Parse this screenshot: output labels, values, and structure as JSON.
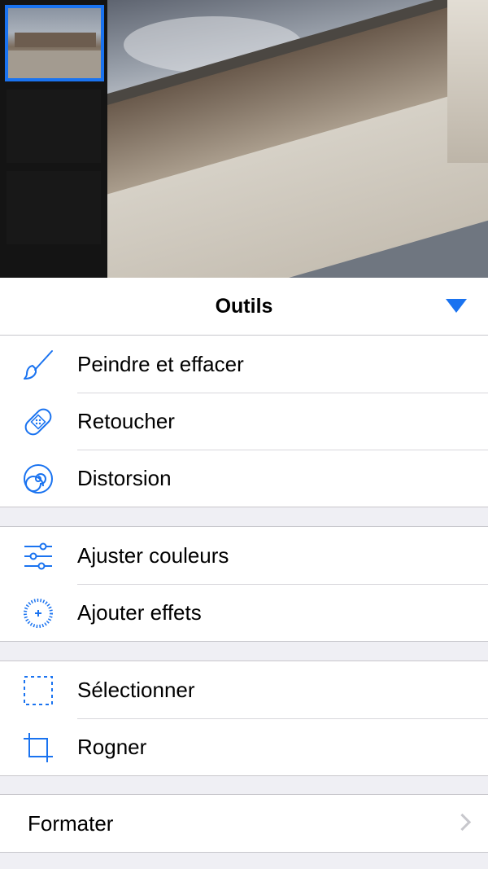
{
  "colors": {
    "accent": "#1a73f0",
    "separator": "#c8c7cc",
    "background": "#efeff4"
  },
  "header": {
    "title": "Outils",
    "collapse_icon": "triangle-down-icon"
  },
  "groups": [
    {
      "items": [
        {
          "label": "Peindre et effacer",
          "icon": "brush-icon"
        },
        {
          "label": "Retoucher",
          "icon": "bandage-icon"
        },
        {
          "label": "Distorsion",
          "icon": "spiral-icon"
        }
      ]
    },
    {
      "items": [
        {
          "label": "Ajuster couleurs",
          "icon": "sliders-icon"
        },
        {
          "label": "Ajouter effets",
          "icon": "sparkle-circle-icon"
        }
      ]
    },
    {
      "items": [
        {
          "label": "Sélectionner",
          "icon": "dashed-selection-icon"
        },
        {
          "label": "Rogner",
          "icon": "crop-icon"
        }
      ]
    },
    {
      "items": [
        {
          "label": "Formater",
          "icon": "chevron-right-icon"
        }
      ]
    }
  ]
}
